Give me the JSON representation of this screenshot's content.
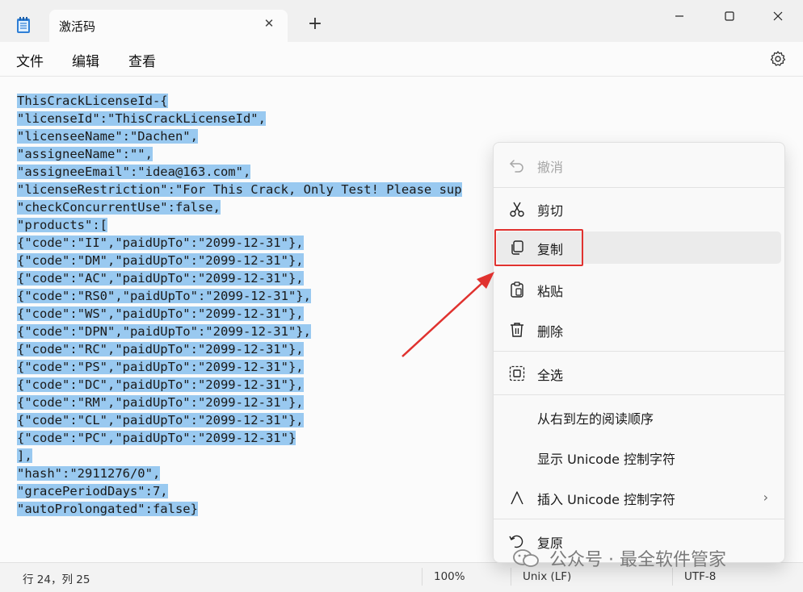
{
  "window": {
    "tab_title": "激活码",
    "new_tab": "+",
    "close_tab": "✕"
  },
  "menu": {
    "file": "文件",
    "edit": "编辑",
    "view": "查看"
  },
  "editor": {
    "lines": [
      "ThisCrackLicenseId-{",
      "\"licenseId\":\"ThisCrackLicenseId\",",
      "\"licenseeName\":\"Dachen\",",
      "\"assigneeName\":\"\",",
      "\"assigneeEmail\":\"idea@163.com\",",
      "\"licenseRestriction\":\"For This Crack, Only Test! Please sup",
      "\"checkConcurrentUse\":false,",
      "\"products\":[",
      "{\"code\":\"II\",\"paidUpTo\":\"2099-12-31\"},",
      "{\"code\":\"DM\",\"paidUpTo\":\"2099-12-31\"},",
      "{\"code\":\"AC\",\"paidUpTo\":\"2099-12-31\"},",
      "{\"code\":\"RS0\",\"paidUpTo\":\"2099-12-31\"},",
      "{\"code\":\"WS\",\"paidUpTo\":\"2099-12-31\"},",
      "{\"code\":\"DPN\",\"paidUpTo\":\"2099-12-31\"},",
      "{\"code\":\"RC\",\"paidUpTo\":\"2099-12-31\"},",
      "{\"code\":\"PS\",\"paidUpTo\":\"2099-12-31\"},",
      "{\"code\":\"DC\",\"paidUpTo\":\"2099-12-31\"},",
      "{\"code\":\"RM\",\"paidUpTo\":\"2099-12-31\"},",
      "{\"code\":\"CL\",\"paidUpTo\":\"2099-12-31\"},",
      "{\"code\":\"PC\",\"paidUpTo\":\"2099-12-31\"}",
      "],",
      "\"hash\":\"2911276/0\",",
      "\"gracePeriodDays\":7,",
      "\"autoProlongated\":false}"
    ],
    "selection_color": "#99c9f0"
  },
  "context_menu": {
    "undo": "撤消",
    "cut": "剪切",
    "copy": "复制",
    "paste": "粘贴",
    "delete": "删除",
    "select_all": "全选",
    "rtl_reading_order": "从右到左的阅读顺序",
    "show_unicode": "显示 Unicode 控制字符",
    "insert_unicode": "插入 Unicode 控制字符",
    "reconvert": "复原",
    "highlight_color": "#e0322f"
  },
  "status": {
    "position": "行 24，列 25",
    "zoom": "100%",
    "line_ending": "Unix (LF)",
    "encoding": "UTF-8"
  },
  "watermark": {
    "text": "公众号 · 最全软件管家"
  }
}
